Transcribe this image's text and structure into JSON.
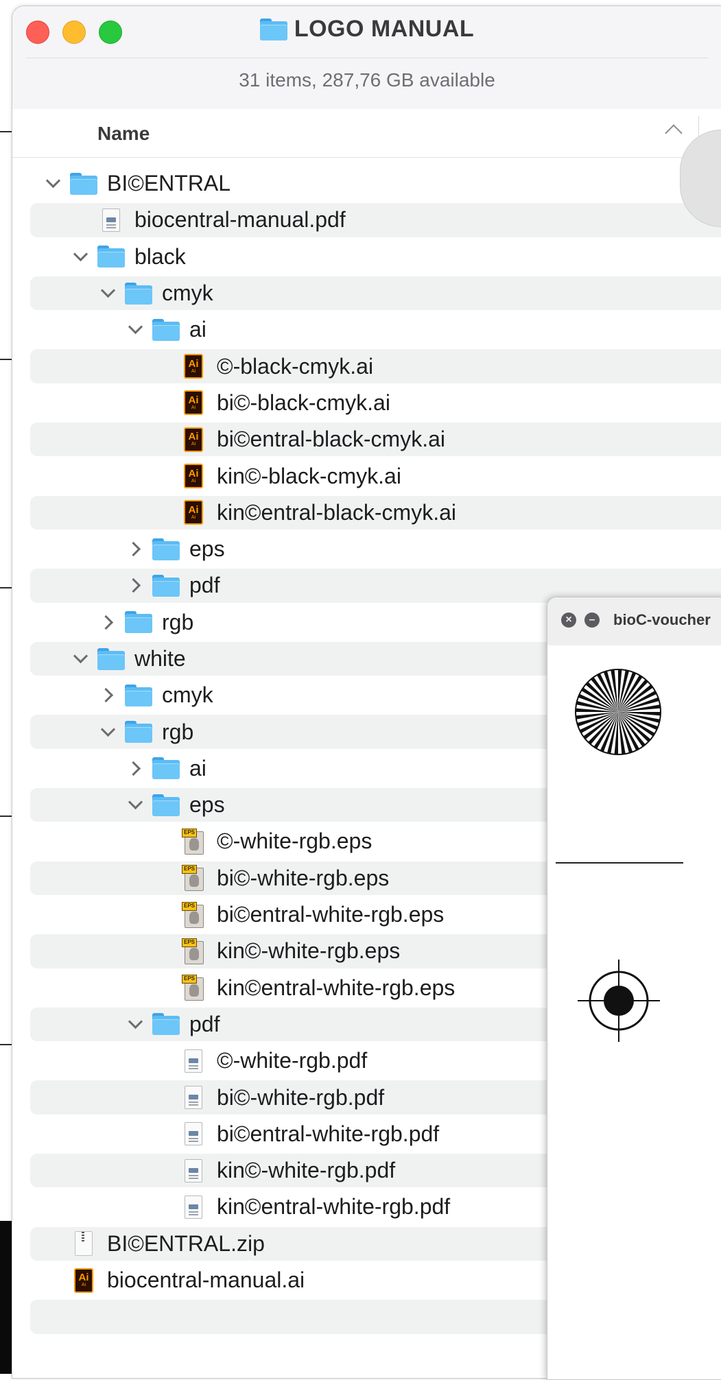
{
  "window": {
    "title": "LOGO MANUAL",
    "status": "31 items, 287,76 GB available",
    "column_header": "Name"
  },
  "rows": [
    {
      "name": "BI©ENTRAL",
      "icon": "folder",
      "depth": 0,
      "disclosure": "expanded",
      "alt": false
    },
    {
      "name": "biocentral-manual.pdf",
      "icon": "pdf",
      "depth": 1,
      "disclosure": "none",
      "alt": true
    },
    {
      "name": "black",
      "icon": "folder",
      "depth": 1,
      "disclosure": "expanded",
      "alt": false
    },
    {
      "name": "cmyk",
      "icon": "folder",
      "depth": 2,
      "disclosure": "expanded",
      "alt": true
    },
    {
      "name": "ai",
      "icon": "folder",
      "depth": 3,
      "disclosure": "expanded",
      "alt": false
    },
    {
      "name": "©-black-cmyk.ai",
      "icon": "ai",
      "depth": 4,
      "disclosure": "none",
      "alt": true
    },
    {
      "name": "bi©-black-cmyk.ai",
      "icon": "ai",
      "depth": 4,
      "disclosure": "none",
      "alt": false
    },
    {
      "name": "bi©entral-black-cmyk.ai",
      "icon": "ai",
      "depth": 4,
      "disclosure": "none",
      "alt": true
    },
    {
      "name": "kin©-black-cmyk.ai",
      "icon": "ai",
      "depth": 4,
      "disclosure": "none",
      "alt": false
    },
    {
      "name": "kin©entral-black-cmyk.ai",
      "icon": "ai",
      "depth": 4,
      "disclosure": "none",
      "alt": true
    },
    {
      "name": "eps",
      "icon": "folder",
      "depth": 3,
      "disclosure": "collapsed",
      "alt": false
    },
    {
      "name": "pdf",
      "icon": "folder",
      "depth": 3,
      "disclosure": "collapsed",
      "alt": true
    },
    {
      "name": "rgb",
      "icon": "folder",
      "depth": 2,
      "disclosure": "collapsed",
      "alt": false
    },
    {
      "name": "white",
      "icon": "folder",
      "depth": 1,
      "disclosure": "expanded",
      "alt": true
    },
    {
      "name": "cmyk",
      "icon": "folder",
      "depth": 2,
      "disclosure": "collapsed",
      "alt": false
    },
    {
      "name": "rgb",
      "icon": "folder",
      "depth": 2,
      "disclosure": "expanded",
      "alt": true
    },
    {
      "name": "ai",
      "icon": "folder",
      "depth": 3,
      "disclosure": "collapsed",
      "alt": false
    },
    {
      "name": "eps",
      "icon": "folder",
      "depth": 3,
      "disclosure": "expanded",
      "alt": true
    },
    {
      "name": "©-white-rgb.eps",
      "icon": "eps",
      "depth": 4,
      "disclosure": "none",
      "alt": false
    },
    {
      "name": "bi©-white-rgb.eps",
      "icon": "eps",
      "depth": 4,
      "disclosure": "none",
      "alt": true
    },
    {
      "name": "bi©entral-white-rgb.eps",
      "icon": "eps",
      "depth": 4,
      "disclosure": "none",
      "alt": false
    },
    {
      "name": "kin©-white-rgb.eps",
      "icon": "eps",
      "depth": 4,
      "disclosure": "none",
      "alt": true
    },
    {
      "name": "kin©entral-white-rgb.eps",
      "icon": "eps",
      "depth": 4,
      "disclosure": "none",
      "alt": false
    },
    {
      "name": "pdf",
      "icon": "folder",
      "depth": 3,
      "disclosure": "expanded",
      "alt": true
    },
    {
      "name": "©-white-rgb.pdf",
      "icon": "pdf",
      "depth": 4,
      "disclosure": "none",
      "alt": false
    },
    {
      "name": "bi©-white-rgb.pdf",
      "icon": "pdf",
      "depth": 4,
      "disclosure": "none",
      "alt": true
    },
    {
      "name": "bi©entral-white-rgb.pdf",
      "icon": "pdf",
      "depth": 4,
      "disclosure": "none",
      "alt": false
    },
    {
      "name": "kin©-white-rgb.pdf",
      "icon": "pdf",
      "depth": 4,
      "disclosure": "none",
      "alt": true
    },
    {
      "name": "kin©entral-white-rgb.pdf",
      "icon": "pdf",
      "depth": 4,
      "disclosure": "none",
      "alt": false
    },
    {
      "name": "BI©ENTRAL.zip",
      "icon": "zip",
      "depth": 0,
      "disclosure": "none",
      "alt": true
    },
    {
      "name": "biocentral-manual.ai",
      "icon": "ai",
      "depth": 0,
      "disclosure": "none",
      "alt": false
    },
    {
      "name": "",
      "icon": "none",
      "depth": 0,
      "disclosure": "none",
      "alt": true
    }
  ],
  "preview": {
    "title": "bioC-voucher"
  },
  "colors": {
    "close": "#fe5f57",
    "minimize": "#febc2e",
    "maximize": "#28c840",
    "folder": "#5dbcf4",
    "row_alt": "#f0f2f2"
  }
}
